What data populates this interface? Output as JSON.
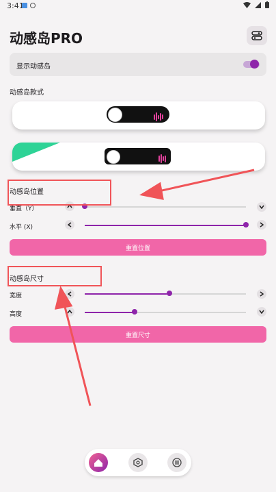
{
  "status_bar": {
    "time": "3:41"
  },
  "header": {
    "title": "动感岛PRO"
  },
  "toggle_card": {
    "label": "显示动感岛",
    "enabled": true
  },
  "styles_section": {
    "label": "动感岛款式"
  },
  "position_section": {
    "label": "动感岛位置",
    "vertical": {
      "label": "垂直（Y）",
      "value": 0.0
    },
    "horizontal": {
      "label": "水平 (X)",
      "value": 1.0
    },
    "reset_label": "重置位置"
  },
  "size_section": {
    "label": "动感岛尺寸",
    "width": {
      "label": "宽度",
      "value": 0.51
    },
    "height": {
      "label": "高度",
      "value": 0.31
    },
    "reset_label": "重置尺寸"
  },
  "colors": {
    "accent": "#8e24aa",
    "pink": "#f166a8",
    "annotation": "#f05458",
    "green": "#2ed396"
  },
  "bottom_nav": {
    "items": [
      "home-icon",
      "hexagon-icon",
      "menu-icon"
    ],
    "active": "home-icon"
  }
}
